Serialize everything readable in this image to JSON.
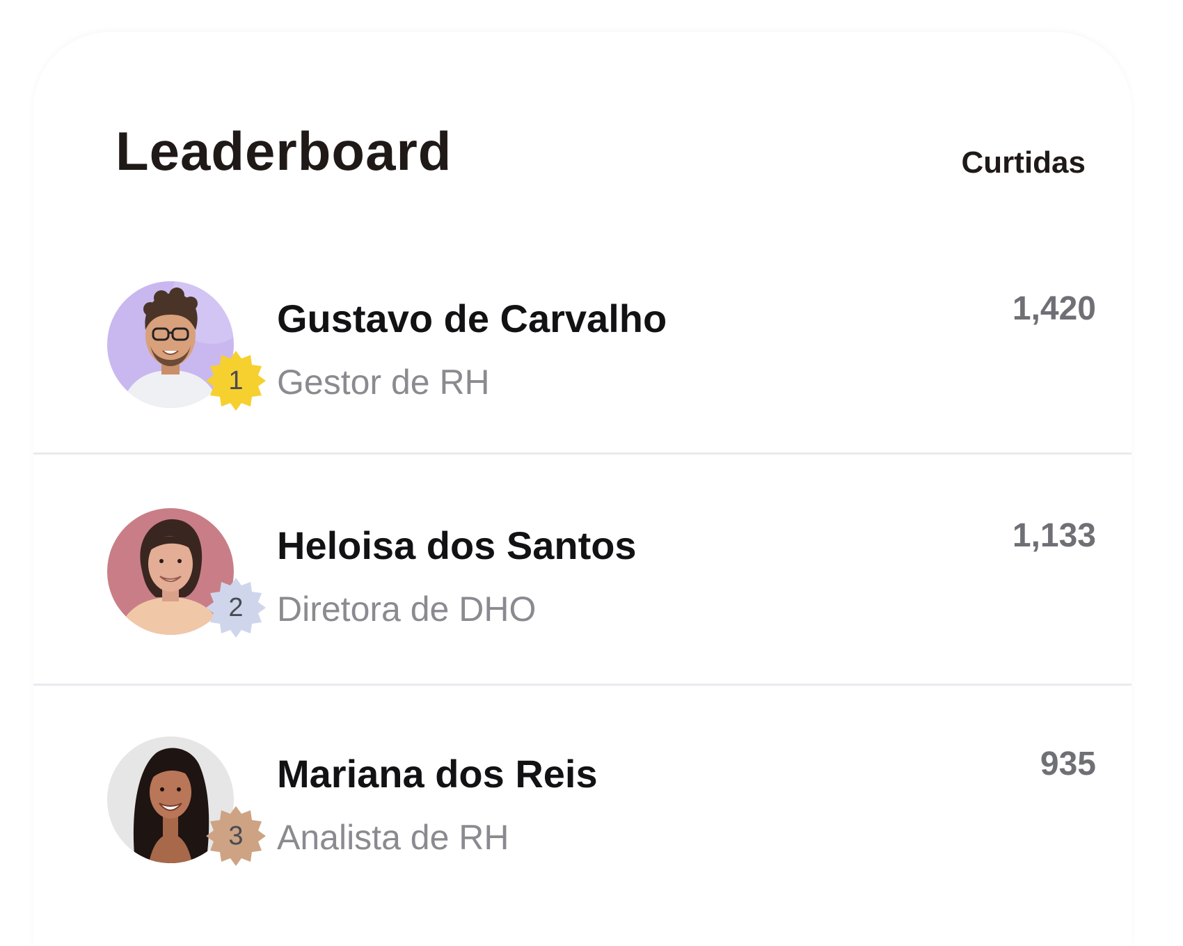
{
  "header": {
    "title": "Leaderboard",
    "column_label": "Curtidas"
  },
  "entries": [
    {
      "rank": "1",
      "name": "Gustavo de Carvalho",
      "role": "Gestor de RH",
      "likes": "1,420",
      "avatar_bg": "#c9b8ef",
      "badge_color": "#f6d02f"
    },
    {
      "rank": "2",
      "name": "Heloisa dos Santos",
      "role": "Diretora de DHO",
      "likes": "1,133",
      "avatar_bg": "#c97e87",
      "badge_color": "#cfd6ec"
    },
    {
      "rank": "3",
      "name": "Mariana dos Reis",
      "role": "Analista de RH",
      "likes": "935",
      "avatar_bg": "#e6e6e6",
      "badge_color": "#cda384"
    }
  ],
  "colors": {
    "title": "#1f1a18",
    "name": "#121214",
    "role": "#8a8a90",
    "likes": "#6f6f76",
    "divider": "#e9e9ee"
  }
}
